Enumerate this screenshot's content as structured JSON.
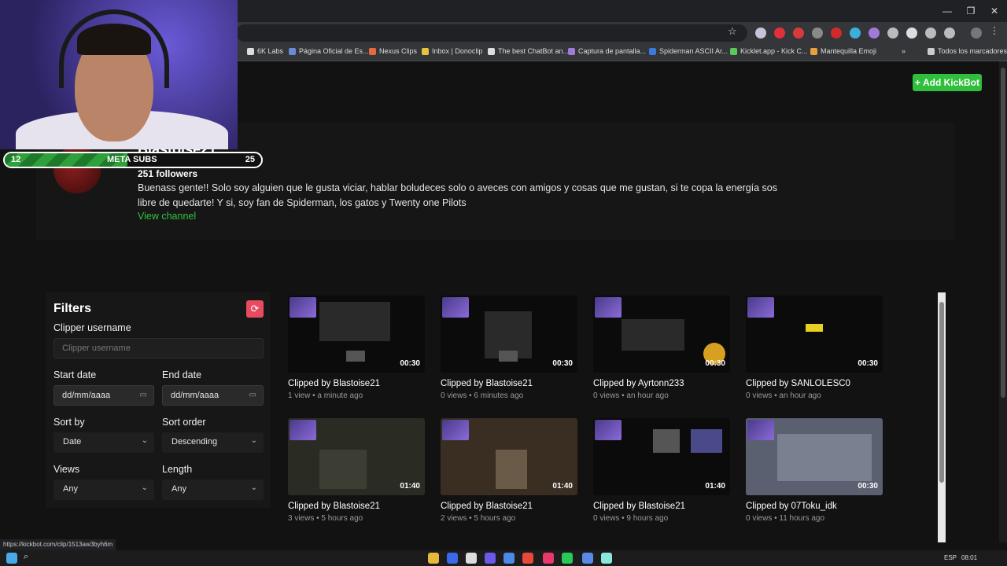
{
  "browser": {
    "bookmarks": [
      "6K Labs",
      "Página Oficial de Es...",
      "Nexus Clips",
      "Inbox | Donoclip",
      "The best ChatBot an...",
      "Captura de pantalla...",
      "Spiderman ASCII Ar...",
      "Kicklet.app - Kick C...",
      "Mantequilla Emoji",
      "Todos los marcadores"
    ],
    "status_url": "https://kickbot.com/clip/1513aw3byh6m"
  },
  "header": {
    "add_label": "+ Add KickBot"
  },
  "channel": {
    "name": "Blastoise21",
    "followers": "251 followers",
    "bio": "Buenass gente!! Solo soy alguien que le gusta viciar, hablar boludeces solo o aveces con amigos y cosas que me gustan, si te copa la energía sos libre de quedarte! Y si, soy fan de Spiderman, los gatos y Twenty one Pilots",
    "view_label": "View channel"
  },
  "filters": {
    "title": "Filters",
    "clipper_label": "Clipper username",
    "clipper_placeholder": "Clipper username",
    "start_label": "Start date",
    "end_label": "End date",
    "date_placeholder": "dd/mm/aaaa",
    "sort_by_label": "Sort by",
    "sort_by_value": "Date",
    "sort_order_label": "Sort order",
    "sort_order_value": "Descending",
    "views_label": "Views",
    "views_value": "Any",
    "length_label": "Length",
    "length_value": "Any"
  },
  "clips": [
    {
      "title": "Clipped by Blastoise21",
      "meta": "1 view • a minute ago",
      "duration": "00:30"
    },
    {
      "title": "Clipped by Blastoise21",
      "meta": "0 views • 6 minutes ago",
      "duration": "00:30"
    },
    {
      "title": "Clipped by Ayrtonn233",
      "meta": "0 views • an hour ago",
      "duration": "00:30"
    },
    {
      "title": "Clipped by SANLOLESC0",
      "meta": "0 views • an hour ago",
      "duration": "00:30"
    },
    {
      "title": "Clipped by Blastoise21",
      "meta": "3 views • 5 hours ago",
      "duration": "01:40"
    },
    {
      "title": "Clipped by Blastoise21",
      "meta": "2 views • 5 hours ago",
      "duration": "01:40"
    },
    {
      "title": "Clipped by Blastoise21",
      "meta": "0 views • 9 hours ago",
      "duration": "01:40"
    },
    {
      "title": "Clipped by 07Toku_idk",
      "meta": "0 views • 11 hours ago",
      "duration": "00:30"
    }
  ],
  "overlay": {
    "meta_label": "META SUBS",
    "current": "12",
    "goal": "25",
    "progress": 0.48
  },
  "taskbar": {
    "lang": "ESP",
    "time": "08:01"
  },
  "colors": {
    "accent": "#2fbf3c",
    "reset": "#e84a5f"
  }
}
